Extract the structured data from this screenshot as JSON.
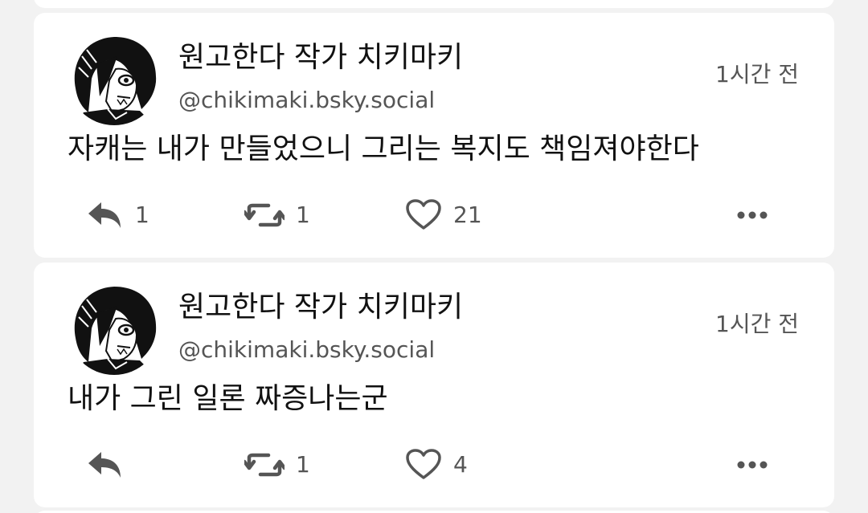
{
  "posts": [
    {
      "author": {
        "display_name": "원고한다 작가 치키마키",
        "handle": "@chikimaki.bsky.social"
      },
      "timestamp": "1시간 전",
      "text": "자캐는 내가 만들었으니 그리는 복지도 책임져야한다",
      "actions": {
        "reply_count": "1",
        "repost_count": "1",
        "like_count": "21",
        "reply_icon": "reply-arrow-icon",
        "repost_icon": "repost-icon",
        "like_icon": "heart-icon",
        "more_icon": "ellipsis-icon"
      }
    },
    {
      "author": {
        "display_name": "원고한다 작가 치키마키",
        "handle": "@chikimaki.bsky.social"
      },
      "timestamp": "1시간 전",
      "text": "내가 그린 일론 짜증나는군",
      "actions": {
        "reply_count": "",
        "repost_count": "1",
        "like_count": "4",
        "reply_icon": "reply-arrow-icon",
        "repost_icon": "repost-icon",
        "like_icon": "heart-icon",
        "more_icon": "ellipsis-icon"
      }
    }
  ],
  "colors": {
    "background": "#f2f2f2",
    "card": "#ffffff",
    "primary_text": "#111111",
    "secondary_text": "#555555",
    "icon": "#555555"
  }
}
